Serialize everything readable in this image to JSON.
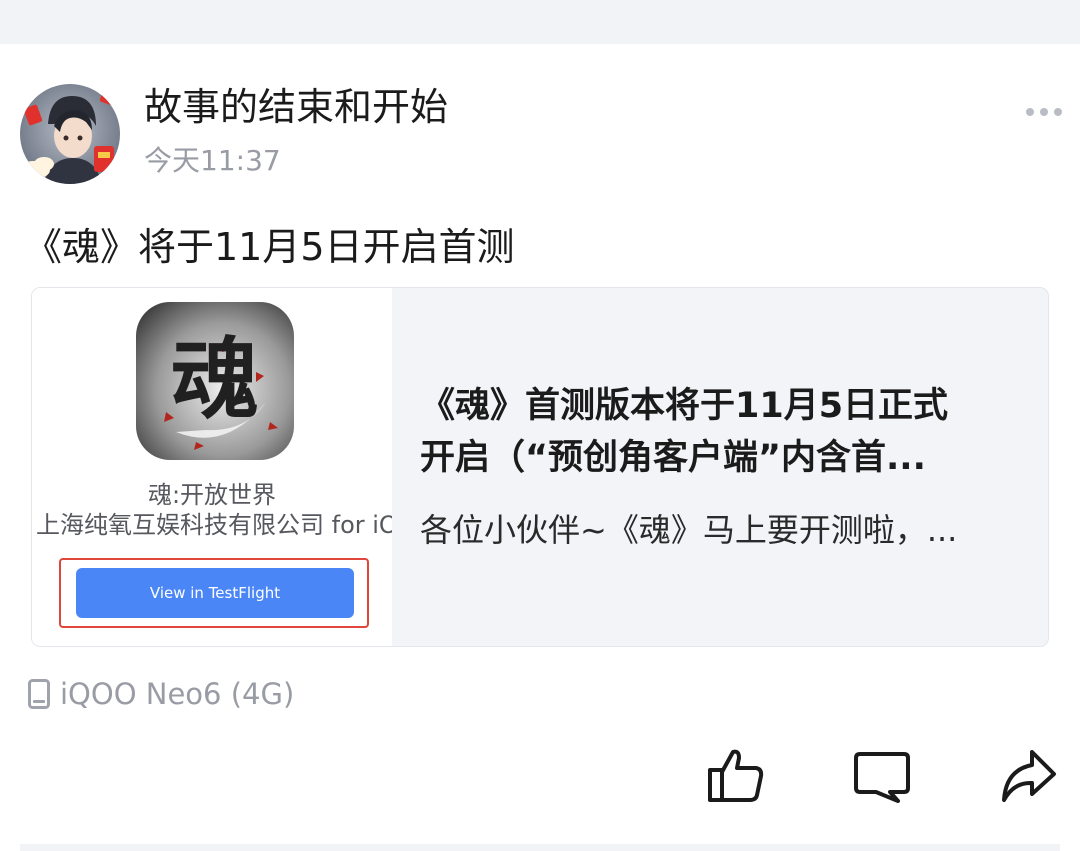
{
  "post": {
    "username": "故事的结束和开始",
    "timestamp": "今天11:37",
    "text": "《魂》将于11月5日开启首测",
    "avatar_icon": "user-avatar",
    "more_icon": "more-dots-icon"
  },
  "link_card": {
    "thumbnail": {
      "app_name": "魂:开放世界",
      "developer": "上海纯氧互娱科技有限公司 for iOS",
      "button_label": "View in TestFlight",
      "app_icon_text": "魂"
    },
    "title_line1": "《魂》首测版本将于11月5日正式",
    "title_line2": "开启（“预创角客户端”内含首...",
    "description": "各位小伙伴~《魂》马上要开测啦，..."
  },
  "device": {
    "label": "iQOO Neo6 (4G)",
    "icon": "phone-icon"
  },
  "actions": [
    {
      "name": "like",
      "icon": "thumbs-up-icon"
    },
    {
      "name": "comment",
      "icon": "comment-icon"
    },
    {
      "name": "share",
      "icon": "share-icon"
    }
  ],
  "colors": {
    "background": "#ffffff",
    "band": "#f2f3f7",
    "muted_text": "#9a9ca5",
    "card_bg": "#f3f4f8",
    "testflight_button": "#4b86f7",
    "highlight_frame": "#e0473a"
  }
}
